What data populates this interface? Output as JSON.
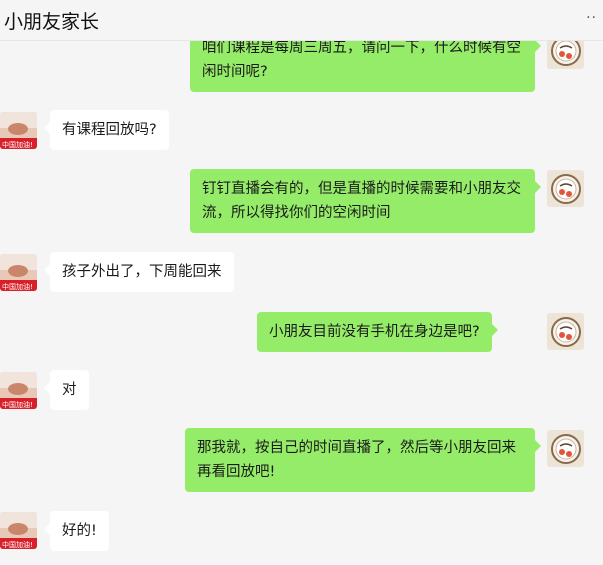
{
  "header": {
    "title": "小朋友家长",
    "more_icon": "more-dots-icon"
  },
  "messages": [
    {
      "side": "right",
      "text": "咱们课程是每周三周五，请问一下，什么时候有空闲时间呢?"
    },
    {
      "side": "left",
      "text": "有课程回放吗?"
    },
    {
      "side": "right",
      "text": "钉钉直播会有的，但是直播的时候需要和小朋友交流，所以得找你们的空闲时间"
    },
    {
      "side": "left",
      "text": "孩子外出了，下周能回来"
    },
    {
      "side": "right",
      "text": "小朋友目前没有手机在身边是吧?"
    },
    {
      "side": "left",
      "text": "对"
    },
    {
      "side": "right",
      "text": "那我就，按自己的时间直播了，然后等小朋友回来再看回放吧!"
    },
    {
      "side": "left",
      "text": "好的!"
    }
  ],
  "avatars": {
    "left_badge": "中国加油!"
  },
  "colors": {
    "background": "#f5f5f5",
    "outgoing_bubble": "#95ec69",
    "incoming_bubble": "#ffffff"
  }
}
